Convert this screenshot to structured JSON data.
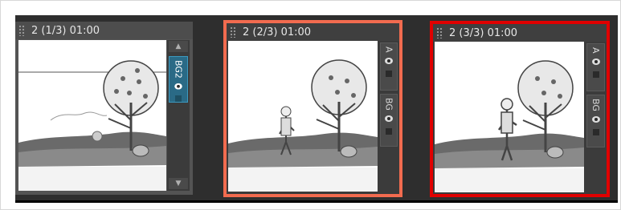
{
  "panels": [
    {
      "header": "2 (1/3) 01:00",
      "layers": [
        {
          "name": "BG2",
          "active": true
        }
      ]
    },
    {
      "header": "2 (2/3) 01:00",
      "layers": [
        {
          "name": "A",
          "active": false
        },
        {
          "name": "BG",
          "active": false
        }
      ]
    },
    {
      "header": "2 (3/3) 01:00",
      "layers": [
        {
          "name": "A",
          "active": false
        },
        {
          "name": "BG",
          "active": false
        }
      ]
    }
  ],
  "colors": {
    "selected_border": "#f26b4f",
    "current_border": "#e00000",
    "active_layer": "#2a6a86"
  },
  "icons": {
    "eye": "eye-icon",
    "up": "scroll-up-icon",
    "down": "scroll-down-icon",
    "grip": "drag-grip-icon"
  }
}
